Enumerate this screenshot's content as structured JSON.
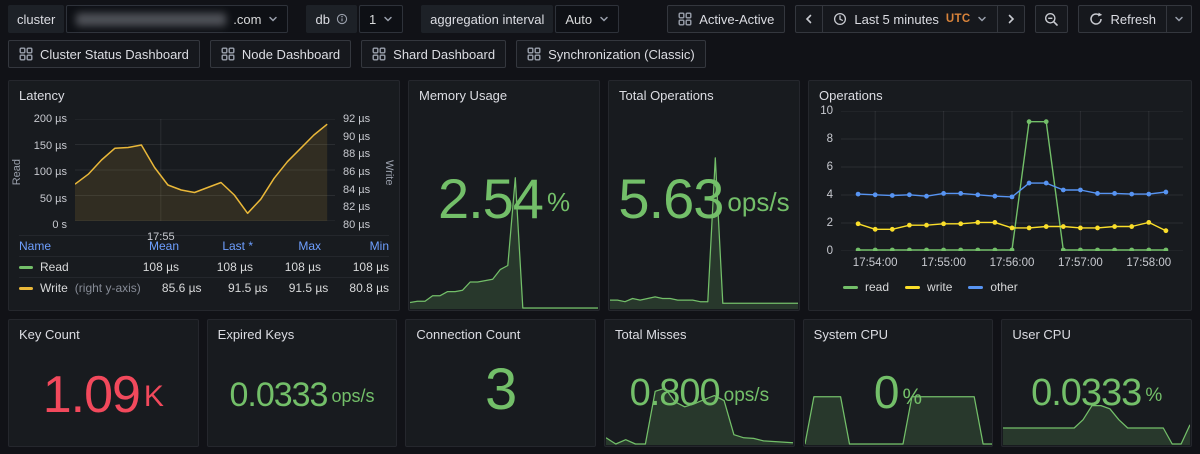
{
  "header": {
    "cluster": {
      "label": "cluster",
      "value_redacted": true,
      "visible_suffix": ".com"
    },
    "db": {
      "label": "db",
      "value": "1"
    },
    "aggregation": {
      "label": "aggregation interval",
      "value": "Auto"
    },
    "active_active_label": "Active-Active",
    "time_range_label": "Last 5 minutes",
    "timezone": "UTC",
    "refresh_label": "Refresh"
  },
  "nav_links": [
    {
      "label": "Cluster Status Dashboard"
    },
    {
      "label": "Node Dashboard"
    },
    {
      "label": "Shard Dashboard"
    },
    {
      "label": "Synchronization (Classic)"
    }
  ],
  "colors": {
    "green": "#73BF69",
    "red": "#F2495C",
    "yellow_latency": "#EAB839",
    "yellow_ops": "#FADE2A",
    "blue": "#5794F2",
    "orange_tz": "#d9833a",
    "legend_header_blue": "#6e9fff"
  },
  "panels": {
    "latency": {
      "title": "Latency",
      "legend": {
        "headers": [
          "Name",
          "Mean",
          "Last *",
          "Max",
          "Min"
        ],
        "rows": [
          {
            "name": "Read",
            "note": "",
            "color": "#73BF69",
            "mean": "108 µs",
            "last": "108 µs",
            "max": "108 µs",
            "min": "108 µs"
          },
          {
            "name": "Write",
            "note": "(right y-axis)",
            "color": "#EAB839",
            "mean": "85.6 µs",
            "last": "91.5 µs",
            "max": "91.5 µs",
            "min": "80.8 µs"
          }
        ]
      }
    },
    "memory": {
      "title": "Memory Usage",
      "value": "2.54",
      "unit": "%",
      "value_color": "#73BF69"
    },
    "total_ops": {
      "title": "Total Operations",
      "value": "5.63",
      "unit": "ops/s",
      "value_color": "#73BF69"
    },
    "operations": {
      "title": "Operations"
    },
    "key_count": {
      "title": "Key Count",
      "value": "1.09",
      "unit": "K",
      "value_color": "#F2495C"
    },
    "expired_keys": {
      "title": "Expired Keys",
      "value": "0.0333",
      "unit": "ops/s",
      "value_color": "#73BF69"
    },
    "connection_count": {
      "title": "Connection Count",
      "value": "3",
      "unit": "",
      "value_color": "#73BF69"
    },
    "total_misses": {
      "title": "Total Misses",
      "value": "0.800",
      "unit": "ops/s",
      "value_color": "#73BF69"
    },
    "system_cpu": {
      "title": "System CPU",
      "value": "0",
      "unit": "%",
      "value_color": "#73BF69"
    },
    "user_cpu": {
      "title": "User CPU",
      "value": "0.0333",
      "unit": "%",
      "value_color": "#73BF69"
    }
  },
  "chart_data": [
    {
      "id": "latency-chart",
      "type": "line",
      "title": "Latency",
      "left_axis": {
        "label": "Read",
        "ticks": [
          "200 µs",
          "150 µs",
          "100 µs",
          "50 µs",
          "0 s"
        ],
        "range": [
          0,
          200
        ]
      },
      "right_axis": {
        "label": "Write",
        "ticks": [
          "92 µs",
          "90 µs",
          "88 µs",
          "86 µs",
          "84 µs",
          "82 µs",
          "80 µs"
        ],
        "range": [
          80,
          92
        ]
      },
      "x_ticks": [
        "17:55"
      ],
      "series": [
        {
          "name": "Read",
          "axis": "left",
          "color": "#73BF69",
          "hidden": true,
          "values": [
            108,
            108,
            108,
            108,
            108,
            108,
            108,
            108,
            108,
            108,
            108,
            108,
            108,
            108,
            108,
            108,
            108,
            108,
            108,
            108
          ]
        },
        {
          "name": "Write",
          "axis": "right",
          "color": "#EAB839",
          "fill": "rgba(234,184,57,0.12)",
          "values": [
            84.3,
            85.5,
            87.2,
            88.6,
            88.7,
            89,
            86.3,
            84.2,
            83.6,
            83.3,
            83.9,
            84.5,
            83,
            80.8,
            82.5,
            85,
            87,
            88.6,
            90.2,
            91.5
          ]
        }
      ]
    },
    {
      "id": "operations-chart",
      "type": "line",
      "title": "Operations",
      "ylim": [
        0,
        10
      ],
      "y_ticks": [
        "10",
        "8",
        "6",
        "4",
        "2",
        "0"
      ],
      "x_ticks": [
        "17:54:00",
        "17:55:00",
        "17:56:00",
        "17:57:00",
        "17:58:00"
      ],
      "legend_position": "bottom",
      "series": [
        {
          "name": "read",
          "color": "#73BF69",
          "values": [
            0,
            0,
            0,
            0,
            0,
            0,
            0,
            0,
            0,
            0,
            9.3,
            9.3,
            0,
            0,
            0,
            0,
            0,
            0,
            0
          ]
        },
        {
          "name": "write",
          "color": "#FADE2A",
          "values": [
            1.9,
            1.5,
            1.5,
            1.8,
            1.8,
            1.9,
            1.9,
            2.0,
            2.0,
            1.6,
            1.6,
            1.7,
            1.7,
            1.6,
            1.6,
            1.7,
            1.7,
            2.0,
            1.4
          ]
        },
        {
          "name": "other",
          "color": "#5794F2",
          "values": [
            4.05,
            4.0,
            3.95,
            4.0,
            3.9,
            4.1,
            4.1,
            4.0,
            3.9,
            3.85,
            4.85,
            4.85,
            4.35,
            4.35,
            4.1,
            4.1,
            4.05,
            4.05,
            4.2
          ]
        }
      ]
    },
    {
      "id": "spark-memory",
      "type": "area",
      "panel": "Memory Usage",
      "color": "#73BF69",
      "fill": "rgba(115,191,105,0.18)",
      "relative_values": [
        0.04,
        0.05,
        0.05,
        0.09,
        0.09,
        0.12,
        0.12,
        0.13,
        0.19,
        0.19,
        0.2,
        0.21,
        0.28,
        0.31,
        0.95,
        0,
        0,
        0,
        0,
        0,
        0,
        0,
        0,
        0,
        0,
        0
      ]
    },
    {
      "id": "spark-totalops",
      "type": "area",
      "panel": "Total Operations",
      "color": "#73BF69",
      "fill": "rgba(115,191,105,0.18)",
      "relative_values": [
        0.05,
        0.05,
        0.04,
        0.06,
        0.05,
        0.06,
        0.07,
        0.06,
        0.06,
        0.05,
        0.05,
        0.05,
        0.04,
        0.04,
        0.95,
        0.03,
        0.03,
        0.03,
        0.03,
        0.03,
        0.03,
        0.03,
        0.03,
        0.03,
        0.03,
        0.03
      ]
    },
    {
      "id": "spark-misses",
      "type": "area",
      "panel": "Total Misses",
      "color": "#73BF69",
      "fill": "rgba(115,191,105,0.18)",
      "relative_values": [
        0.1,
        0.0,
        0.07,
        0.0,
        0.0,
        0.85,
        0.9,
        0.68,
        0.6,
        0.65,
        0.72,
        0.78,
        0.7,
        0.15,
        0.1,
        0.09,
        0.05,
        0.04,
        0.03,
        0.02
      ]
    },
    {
      "id": "spark-system",
      "type": "area",
      "panel": "System CPU",
      "color": "#73BF69",
      "fill": "rgba(115,191,105,0.18)",
      "relative_values": [
        0,
        0.55,
        0.55,
        0.55,
        0.55,
        0,
        0,
        0,
        0,
        0,
        0,
        0,
        0.55,
        0.55,
        0.55,
        0.55,
        0.55,
        0.55,
        0.55,
        0.55,
        0,
        0
      ]
    },
    {
      "id": "spark-user",
      "type": "area",
      "panel": "User CPU",
      "color": "#73BF69",
      "fill": "rgba(115,191,105,0.18)",
      "relative_values": [
        0.25,
        0.25,
        0.25,
        0.25,
        0.25,
        0.25,
        0.25,
        0.25,
        0.25,
        0.38,
        0.6,
        0.6,
        0.55,
        0.38,
        0.25,
        0.25,
        0.25,
        0.25,
        0.25,
        0,
        0,
        0.3
      ]
    }
  ]
}
